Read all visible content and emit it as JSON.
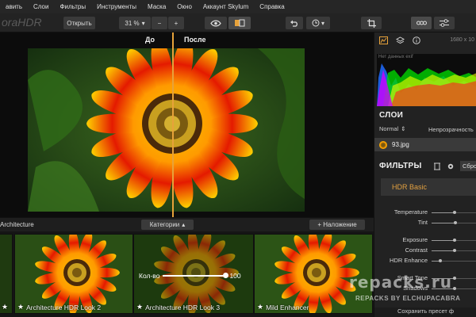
{
  "menu": [
    "авить",
    "Слои",
    "Фильтры",
    "Инструменты",
    "Маска",
    "Окно",
    "Аккаунт Skylum",
    "Справка"
  ],
  "app_logo": "oraHDR",
  "toolbar": {
    "open_label": "Открыть",
    "zoom_value": "31 %",
    "zoom_out_label": "−",
    "zoom_in_label": "+"
  },
  "compare": {
    "before": "До",
    "after": "После"
  },
  "strip": {
    "title": "Architecture",
    "categories_label": "Категории",
    "overlay_label": "+ Наложение"
  },
  "thumbnails": [
    {
      "label": ""
    },
    {
      "label": "Architecture HDR Look 2"
    },
    {
      "label": "Architecture HDR Look 3"
    },
    {
      "label": "Mild Enhancer"
    },
    {
      "label": ""
    }
  ],
  "amount": {
    "label": "Кол-во",
    "value": "100",
    "level": 1.0
  },
  "right_panel": {
    "image_dims": "1680 x 10",
    "histogram_label": "Нет данных exif",
    "layers_title": "СЛОИ",
    "blend_mode": "Normal",
    "opacity_label": "Непрозрачность",
    "layer_name": "93.jpg",
    "filters_title": "ФИЛЬТРЫ",
    "reset_label": "Сбро",
    "filter_name": "HDR Basic",
    "sliders": [
      {
        "label": "Temperature",
        "level": 0.5
      },
      {
        "label": "Tint",
        "level": 0.52
      },
      {
        "label": "Exposure",
        "level": 0.5
      },
      {
        "label": "Contrast",
        "level": 0.5
      },
      {
        "label": "HDR Enhance",
        "level": 0.2
      },
      {
        "label": "Smart Tone",
        "level": 0.5
      },
      {
        "label": "Shadows",
        "level": 0.5
      }
    ],
    "footer": "Сохранить пресет ф"
  },
  "watermark": {
    "main": "repacks.ru",
    "sub": "REPACKS BY ELCHUPACABRA"
  },
  "colors": {
    "accent": "#e7a23a",
    "panel": "#222222",
    "canvas": "#0c0c0c"
  }
}
